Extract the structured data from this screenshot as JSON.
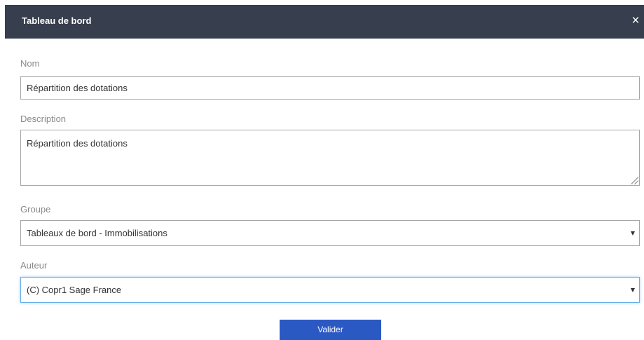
{
  "dialog": {
    "title": "Tableau de bord",
    "close_icon": "close-icon",
    "close_glyph": "×"
  },
  "form": {
    "name": {
      "label": "Nom",
      "value": "Répartition des dotations"
    },
    "description": {
      "label": "Description",
      "value": "Répartition des dotations"
    },
    "group": {
      "label": "Groupe",
      "selected": "Tableaux de bord - Immobilisations",
      "icon": "chevron-down-icon"
    },
    "author": {
      "label": "Auteur",
      "selected": "(C) Copr1 Sage France",
      "icon": "chevron-down-icon"
    }
  },
  "actions": {
    "submit_label": "Valider"
  },
  "colors": {
    "header_bg": "#373e4d",
    "button_bg": "#2b59c3",
    "label_text": "#8a8a8a",
    "border": "#a6a6a6",
    "focus_border": "#66afe9"
  }
}
